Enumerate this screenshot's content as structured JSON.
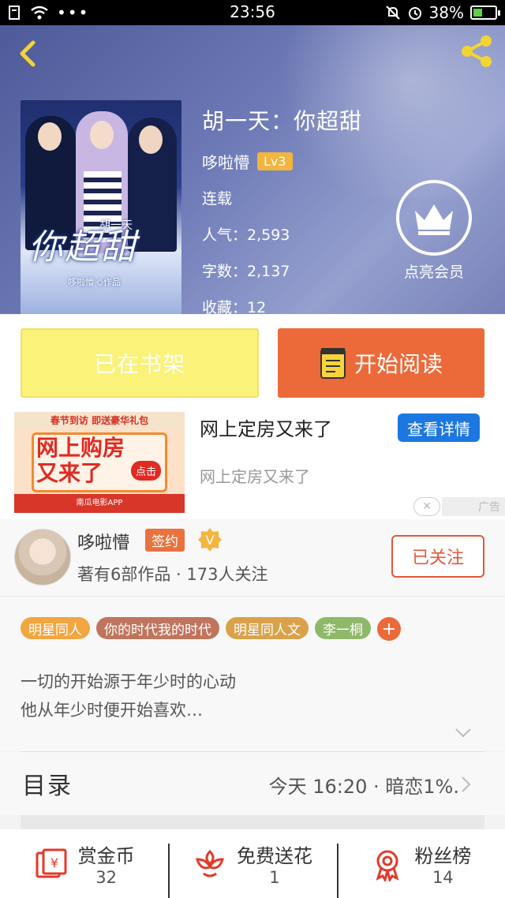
{
  "status_bar": {
    "time": "23:56",
    "battery": "38%",
    "battery_fraction": 0.38
  },
  "book": {
    "title": "胡一天：你超甜",
    "author": "哆啦懵",
    "level": "Lv3",
    "status": "连载",
    "popularity": "人气：2,593",
    "word_count": "字数：2,137",
    "favorites": "收藏：12",
    "cover_title": "你超甜",
    "cover_subtitle": "胡一天",
    "cover_author": "哆啦懵 ◇作品"
  },
  "vip": {
    "label": "点亮会员"
  },
  "actions": {
    "shelf_label": "已在书架",
    "read_label": "开始阅读"
  },
  "ad": {
    "title": "网上定房又来了",
    "description": "网上定房又来了",
    "button": "查看详情",
    "tag": "广告",
    "image_top": "春节到访 即送豪华礼包",
    "image_big_line1": "网上购房",
    "image_big_line2": "又来了",
    "image_click": "点击",
    "image_footer": "南瓜电影APP"
  },
  "author_card": {
    "name": "哆啦懵",
    "sign_badge": "签约",
    "v_badge": "V",
    "meta": "著有6部作品 · 173人关注",
    "follow_label": "已关注"
  },
  "tags": [
    {
      "label": "明星同人",
      "color": "#f2a640"
    },
    {
      "label": "你的时代我的时代",
      "color": "#c0745c"
    },
    {
      "label": "明星同人文",
      "color": "#d9a24a"
    },
    {
      "label": "李一桐",
      "color": "#8fb86a"
    }
  ],
  "tag_more": "+",
  "synopsis": {
    "line1": "一切的开始源于年少时的心动",
    "line2": "他从年少时便开始喜欢…"
  },
  "catalog": {
    "title": "目录",
    "meta": "今天 16:20 · 暗恋1%."
  },
  "bottom_bar": [
    {
      "label": "赏金币",
      "count": "32",
      "icon": "reward-coin-icon"
    },
    {
      "label": "免费送花",
      "count": "1",
      "icon": "flower-icon"
    },
    {
      "label": "粉丝榜",
      "count": "14",
      "icon": "fan-rank-icon"
    }
  ],
  "colors": {
    "accent": "#ec6a3a",
    "shelf": "#fbf27a",
    "ad_button": "#1c78e0"
  }
}
